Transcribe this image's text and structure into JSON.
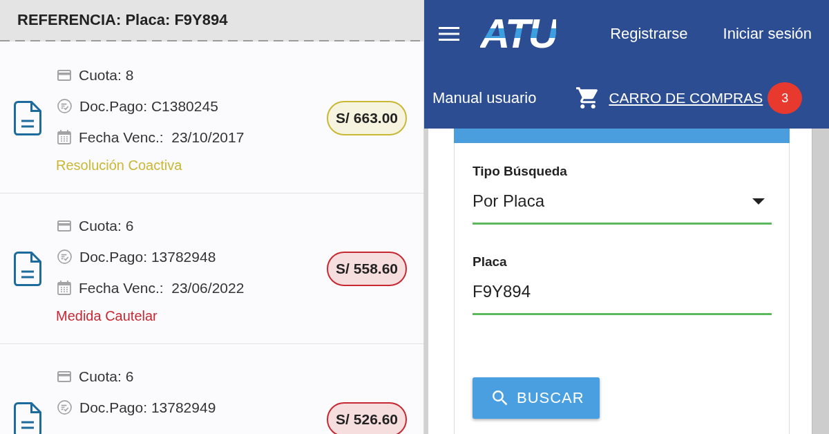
{
  "reference_panel": {
    "title": "REFERENCIA: Placa: F9Y894",
    "items": [
      {
        "cuota": "Cuota: 8",
        "doc_pago": "Doc.Pago: C1380245",
        "fecha_venc": "Fecha Venc.:  23/10/2017",
        "status": "Resolución Coactiva",
        "amount": "S/ 663.00",
        "color": "#c9b833"
      },
      {
        "cuota": "Cuota: 6",
        "doc_pago": "Doc.Pago: 13782948",
        "fecha_venc": "Fecha Venc.:  23/06/2022",
        "status": "Medida Cautelar",
        "amount": "S/ 558.60",
        "color": "#c62832"
      },
      {
        "cuota": "Cuota: 6",
        "doc_pago": "Doc.Pago: 13782949",
        "amount": "S/ 526.60",
        "color": "#c62832"
      }
    ]
  },
  "site_header": {
    "logo": "ATU",
    "nav_links": [
      "Registrarse",
      "Iniciar sesión"
    ],
    "manual_link": "Manual usuario",
    "cart_link": "CARRO DE COMPRAS",
    "cart_count": "3"
  },
  "search_form": {
    "fields": [
      {
        "kind": "select",
        "label": "Tipo Búsqueda",
        "value": "Por Placa"
      },
      {
        "kind": "text",
        "label": "Placa",
        "value": "F9Y894"
      }
    ],
    "button": "BUSCAR"
  }
}
